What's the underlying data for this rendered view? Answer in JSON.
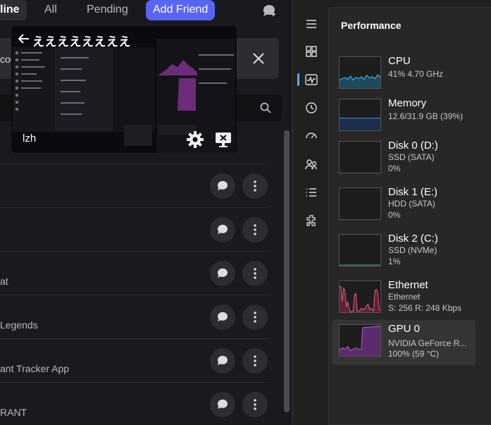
{
  "tabs": [
    {
      "label": "line",
      "active": true
    },
    {
      "label": "All"
    },
    {
      "label": "Pending"
    },
    {
      "label": "Add Friend"
    }
  ],
  "notice": {
    "text": "cou"
  },
  "overlay": {
    "title": "ええええええええ",
    "user": "lzh"
  },
  "rows": [
    {
      "name": ""
    },
    {
      "name": ""
    },
    {
      "name": "at"
    },
    {
      "name": "Legends"
    },
    {
      "name": "ant Tracker App"
    },
    {
      "name": "RANT"
    }
  ],
  "taskmanager": {
    "title": "Performance",
    "items": [
      {
        "name": "CPU",
        "line1": "41%  4.70 GHz",
        "line2": "",
        "line3": "",
        "color": "#4cc2ff"
      },
      {
        "name": "Memory",
        "line1": "12.6/31.9 GB (39%)",
        "line2": "",
        "line3": "",
        "color": "#5b8de6"
      },
      {
        "name": "Disk 0 (D:)",
        "line1": "SSD (SATA)",
        "line2": "0%",
        "line3": "",
        "color": "#67c06a"
      },
      {
        "name": "Disk 1 (E:)",
        "line1": "HDD (SATA)",
        "line2": "0%",
        "line3": "",
        "color": "#67c06a"
      },
      {
        "name": "Disk 2 (C:)",
        "line1": "SSD (NVMe)",
        "line2": "1%",
        "line3": "",
        "color": "#67c06a"
      },
      {
        "name": "Ethernet",
        "line1": "Ethernet",
        "line2": "S: 256  R: 248 Kbps",
        "line3": "",
        "color": "#e8607e"
      },
      {
        "name": "GPU 0",
        "line1": "NVIDIA GeForce R...",
        "line2": "100%  (59 °C)",
        "line3": "",
        "color": "#b36bd1"
      }
    ]
  }
}
